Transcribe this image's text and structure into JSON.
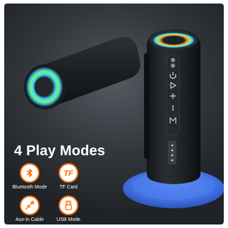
{
  "headline": "4 Play Modes",
  "modes": [
    {
      "label": "Bluetooth Mode",
      "icon": "bluetooth-icon"
    },
    {
      "label": "TF Card",
      "icon": "tf-card-icon"
    },
    {
      "label": "Aux-in Cable",
      "icon": "aux-cable-icon"
    },
    {
      "label": "USB Mode",
      "icon": "usb-icon"
    }
  ],
  "colors": {
    "accent": "#ff6a00",
    "background": "#33373c",
    "stand": "#3f6fe0"
  }
}
